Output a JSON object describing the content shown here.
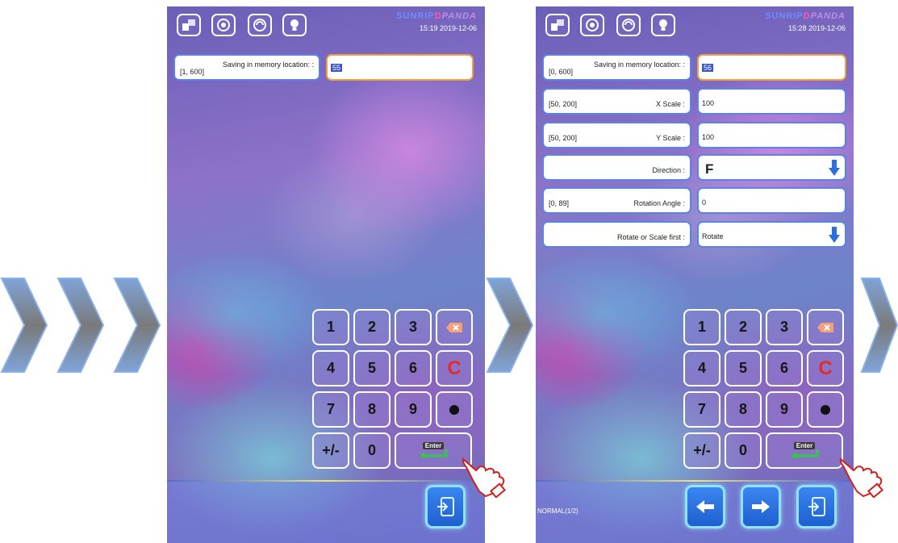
{
  "colors": {
    "field_border": "#5b82e6",
    "active_border": "#f0a040",
    "clear_key": "#e22b2b",
    "nav_button": "#2a70e0"
  },
  "icons": {
    "flow_arrows": "chevron-right-icon",
    "topbar": [
      "windows-icon",
      "globe-settings-icon",
      "cycle-icon",
      "lightbulb-icon"
    ],
    "backspace": "backspace-icon",
    "dot": "dot-icon",
    "enter": "enter-arrow-icon",
    "exit": "exit-icon",
    "prev": "arrow-left-icon",
    "next": "arrow-right-icon",
    "dropdown": "arrow-down-icon",
    "pointer": "pointing-hand-icon"
  },
  "logo": {
    "part1": "SUNRIP",
    "part2": "D",
    "part3": "PANDA"
  },
  "screen1": {
    "time": "15:19   2019-12-06",
    "memory_label": "Saving in memory location: :",
    "memory_range": "[1, 600]",
    "memory_value": "55"
  },
  "screen2": {
    "time": "15:28   2019-12-06",
    "memory_label": "Saving in memory location: :",
    "memory_range": "[0, 600]",
    "memory_value": "56",
    "x_scale_range": "[50, 200]",
    "x_scale_label": "X Scale :",
    "x_scale_value": "100",
    "y_scale_range": "[50, 200]",
    "y_scale_label": "Y Scale :",
    "y_scale_value": "100",
    "direction_label": "Direction :",
    "direction_value": "F",
    "angle_range": "[0, 89]",
    "angle_label": "Rotation Angle :",
    "angle_value": "0",
    "order_label": "Rotate or Scale first :",
    "order_value": "Rotate",
    "status": "NORMAL(1/2)"
  },
  "keypad": {
    "k1": "1",
    "k2": "2",
    "k3": "3",
    "k4": "4",
    "k5": "5",
    "k6": "6",
    "clear": "C",
    "k7": "7",
    "k8": "8",
    "k9": "9",
    "plusminus": "+/-",
    "k0": "0",
    "enter": "Enter"
  }
}
